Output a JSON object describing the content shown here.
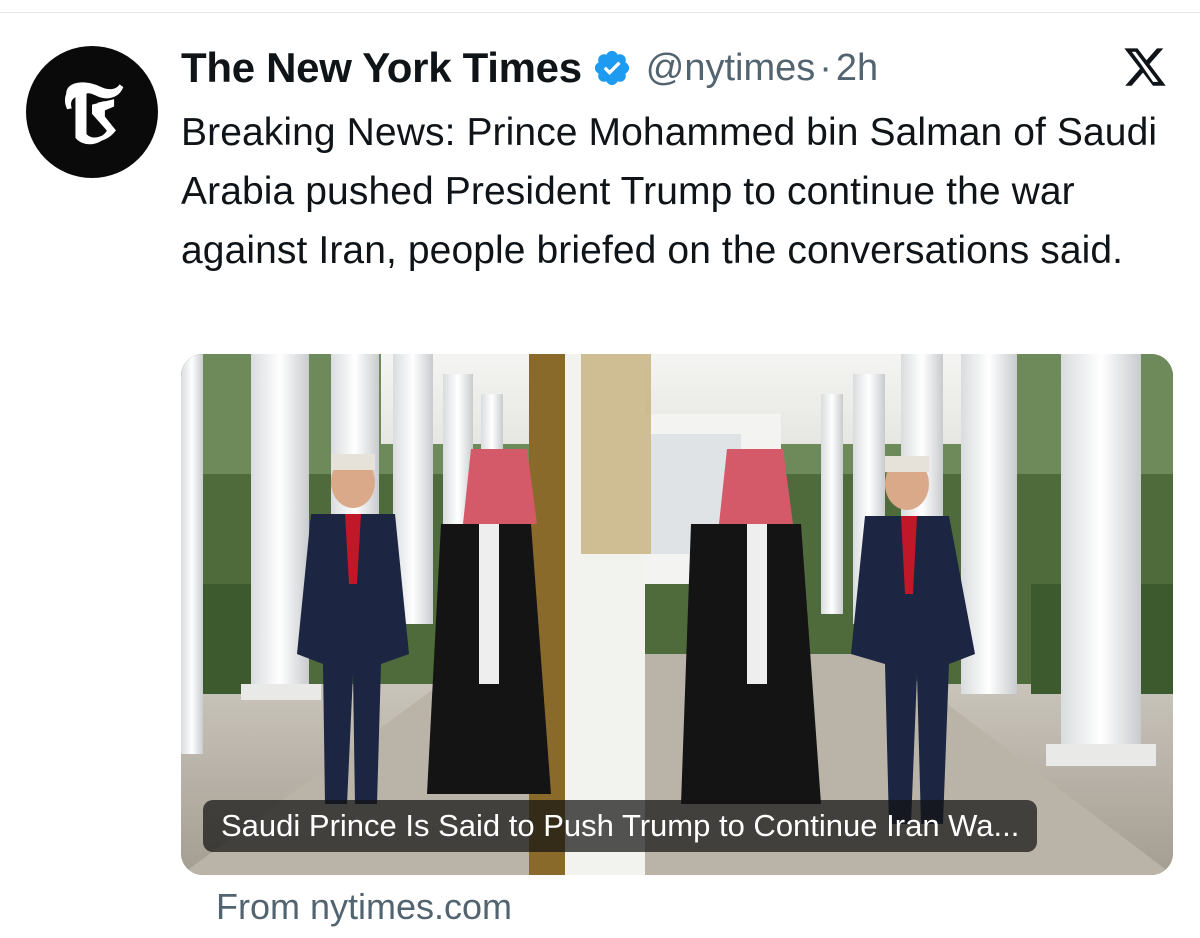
{
  "tweet": {
    "author": {
      "display_name": "The New York Times",
      "handle": "@nytimes",
      "verified": true,
      "avatar_icon": "nyt-t-logo-icon"
    },
    "separator": "·",
    "timestamp": "2h",
    "platform_icon": "x-logo-icon",
    "text": "Breaking News: Prince Mohammed bin Salman of Saudi Arabia pushed President Trump to continue the war against Iran, people briefed on the conversations said.",
    "card": {
      "headline": "Saudi Prince Is Said to Push Trump to Continue Iran Wa...",
      "source": "From nytimes.com"
    }
  },
  "colors": {
    "verified_badge": "#1d9bf0",
    "secondary_text": "#536471",
    "primary_text": "#0f1419"
  }
}
